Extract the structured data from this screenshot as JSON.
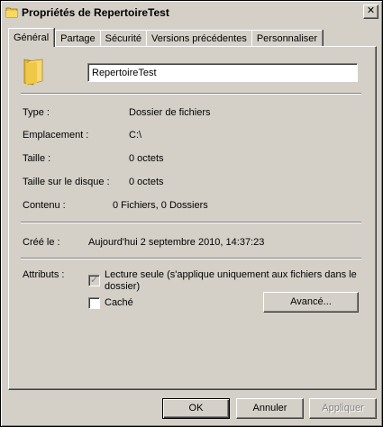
{
  "window": {
    "title": "Propriétés de RepertoireTest",
    "close_label": "✕"
  },
  "tabs": [
    {
      "label": "Général",
      "active": true
    },
    {
      "label": "Partage"
    },
    {
      "label": "Sécurité"
    },
    {
      "label": "Versions précédentes"
    },
    {
      "label": "Personnaliser"
    }
  ],
  "general": {
    "name_value": "RepertoireTest",
    "type_label": "Type :",
    "type_value": "Dossier de fichiers",
    "location_label": "Emplacement :",
    "location_value": "C:\\",
    "size_label": "Taille :",
    "size_value": "0 octets",
    "size_on_disk_label": "Taille sur le disque :",
    "size_on_disk_value": "0 octets",
    "contents_label": "Contenu :",
    "contents_value": "0 Fichiers, 0 Dossiers",
    "created_label": "Créé le :",
    "created_value": "Aujourd'hui 2 septembre 2010, 14:37:23",
    "attributes_label": "Attributs :",
    "readonly_label_line1": "Lecture seule (s'applique uniquement aux fichiers dans le",
    "readonly_label_line2": "dossier)",
    "readonly_checked": true,
    "hidden_label": "Caché",
    "hidden_checked": false,
    "advanced_button": "Avancé..."
  },
  "footer": {
    "ok": "OK",
    "cancel": "Annuler",
    "apply": "Appliquer"
  },
  "icons": {
    "title_icon": "folder-icon",
    "big_icon": "folder-icon"
  },
  "colors": {
    "folder": "#f0c43a",
    "face": "#d4d0c8"
  }
}
